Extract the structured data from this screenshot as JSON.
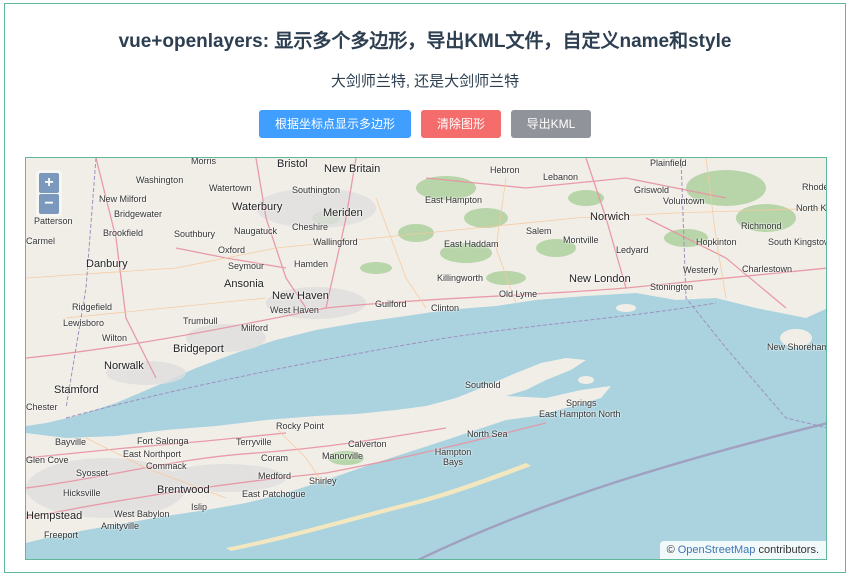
{
  "header": {
    "title": "vue+openlayers: 显示多个多边形，导出KML文件，自定义name和style",
    "subtitle": "大剑师兰特, 还是大剑师兰特"
  },
  "toolbar": {
    "show_polygons_label": "根据坐标点显示多边形",
    "clear_label": "清除图形",
    "export_label": "导出KML"
  },
  "map": {
    "zoom_in": "+",
    "zoom_out": "−",
    "attribution_prefix": "©",
    "attribution_link": "OpenStreetMap",
    "attribution_suffix": "contributors.",
    "places": [
      {
        "name": "Morris"
      },
      {
        "name": "Bristol"
      },
      {
        "name": "New Britain"
      },
      {
        "name": "Hebron"
      },
      {
        "name": "Plainfield"
      },
      {
        "name": "Washington"
      },
      {
        "name": "Watertown"
      },
      {
        "name": "Southington"
      },
      {
        "name": "Lebanon"
      },
      {
        "name": "Griswold"
      },
      {
        "name": "New Milford"
      },
      {
        "name": "Waterbury"
      },
      {
        "name": "Meriden"
      },
      {
        "name": "East Hampton"
      },
      {
        "name": "Voluntown"
      },
      {
        "name": "Bridgewater"
      },
      {
        "name": "Cheshire"
      },
      {
        "name": "Norwich"
      },
      {
        "name": "Patterson"
      },
      {
        "name": "Brookfield"
      },
      {
        "name": "Southbury"
      },
      {
        "name": "Naugatuck"
      },
      {
        "name": "Wallingford"
      },
      {
        "name": "Salem"
      },
      {
        "name": "Montville"
      },
      {
        "name": "Richmond"
      },
      {
        "name": "Carmel"
      },
      {
        "name": "Oxford"
      },
      {
        "name": "East Haddam"
      },
      {
        "name": "Ledyard"
      },
      {
        "name": "Hopkinton"
      },
      {
        "name": "South Kingstown"
      },
      {
        "name": "Danbury"
      },
      {
        "name": "Seymour"
      },
      {
        "name": "Hamden"
      },
      {
        "name": "Westerly"
      },
      {
        "name": "Charlestown"
      },
      {
        "name": "Ansonia"
      },
      {
        "name": "Killingworth"
      },
      {
        "name": "New London"
      },
      {
        "name": "Stonington"
      },
      {
        "name": "New Haven"
      },
      {
        "name": "Guilford"
      },
      {
        "name": "Old Lyme"
      },
      {
        "name": "Ridgefield"
      },
      {
        "name": "West Haven"
      },
      {
        "name": "Clinton"
      },
      {
        "name": "Trumbull"
      },
      {
        "name": "Lewisboro"
      },
      {
        "name": "Milford"
      },
      {
        "name": "Wilton"
      },
      {
        "name": "Bridgeport"
      },
      {
        "name": "New Shoreham"
      },
      {
        "name": "Norwalk"
      },
      {
        "name": "Southold"
      },
      {
        "name": "Stamford"
      },
      {
        "name": "Springs"
      },
      {
        "name": "Chester"
      },
      {
        "name": "East Hampton North"
      },
      {
        "name": "Rocky Point"
      },
      {
        "name": "North Sea"
      },
      {
        "name": "Bayville"
      },
      {
        "name": "Fort Salonga"
      },
      {
        "name": "Terryville"
      },
      {
        "name": "Calverton"
      },
      {
        "name": "East Northport"
      },
      {
        "name": "Coram"
      },
      {
        "name": "Manorville"
      },
      {
        "name": "Hampton Bays"
      },
      {
        "name": "Glen Cove"
      },
      {
        "name": "Commack"
      },
      {
        "name": "Syosset"
      },
      {
        "name": "Medford"
      },
      {
        "name": "Shirley"
      },
      {
        "name": "Hicksville"
      },
      {
        "name": "Brentwood"
      },
      {
        "name": "East Patchogue"
      },
      {
        "name": "Hempstead"
      },
      {
        "name": "West Babylon"
      },
      {
        "name": "Islip"
      },
      {
        "name": "Amityville"
      },
      {
        "name": "Freeport"
      },
      {
        "name": "Rhode"
      },
      {
        "name": "North K"
      }
    ]
  }
}
